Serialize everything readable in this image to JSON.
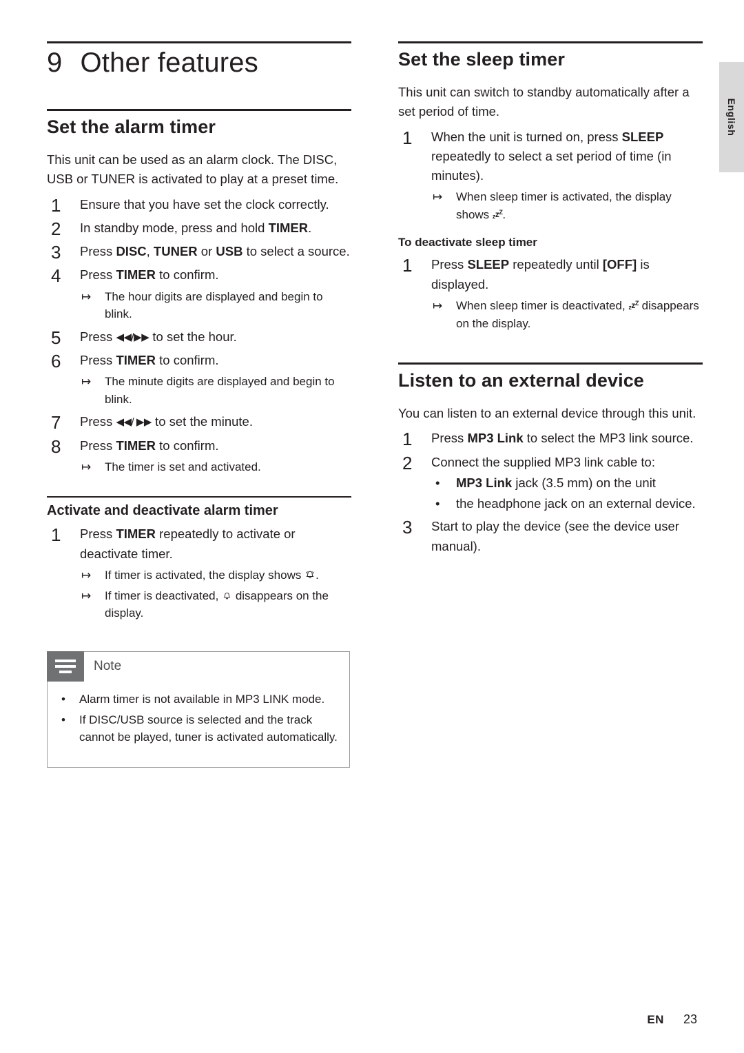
{
  "side_tab": {
    "label": "English"
  },
  "chapter": {
    "number": "9",
    "title": "Other features"
  },
  "left": {
    "alarm": {
      "heading": "Set the alarm timer",
      "intro": "This unit can be used as an alarm clock. The DISC, USB or TUNER is activated to play at a preset time.",
      "steps": [
        "Ensure that you have set the clock correctly.",
        "In standby mode, press and hold TIMER.",
        "Press DISC, TUNER or USB to select a source.",
        "Press TIMER to confirm.",
        "Press ◄◄/►► to set the hour.",
        "Press TIMER to confirm.",
        "Press ◄◄/ ►► to set the minute.",
        "Press TIMER to confirm."
      ],
      "note_after_4": "The hour digits are displayed and begin to blink.",
      "note_after_6": "The minute digits are displayed and begin to blink.",
      "note_after_8": "The timer is set and activated."
    },
    "activate": {
      "heading": "Activate and deactivate alarm timer",
      "step1": "Press TIMER repeatedly to activate or deactivate timer.",
      "note1": "If timer is activated, the display shows",
      "note2a": "If timer is deactivated,",
      "note2b": "disappears on the display."
    },
    "note": {
      "title": "Note",
      "items": [
        "Alarm timer is not available in MP3 LINK mode.",
        "If DISC/USB source is selected and the track cannot be played, tuner is activated automatically."
      ]
    }
  },
  "right": {
    "sleep": {
      "heading": "Set the sleep timer",
      "intro": "This unit can switch to standby automatically after a set period of time.",
      "step1": "When the unit is turned on, press SLEEP repeatedly to select a set period of time (in minutes).",
      "note1a": "When sleep timer is activated, the display shows",
      "deactivate_title": "To deactivate sleep timer",
      "deactivate_step1": "Press SLEEP repeatedly until [OFF] is displayed.",
      "deactivate_note_a": "When sleep timer is deactivated,",
      "deactivate_note_b": "disappears on the display."
    },
    "external": {
      "heading": "Listen to an external device",
      "intro": "You can listen to an external device through this unit.",
      "step1": "Press MP3 Link to select the MP3 link source.",
      "step2": "Connect the supplied MP3 link cable to:",
      "bullets": [
        "MP3 Link jack (3.5 mm) on the unit",
        "the headphone jack on an external device."
      ],
      "step3": "Start to play the device (see the device user manual)."
    }
  },
  "footer": {
    "lang": "EN",
    "page": "23"
  }
}
